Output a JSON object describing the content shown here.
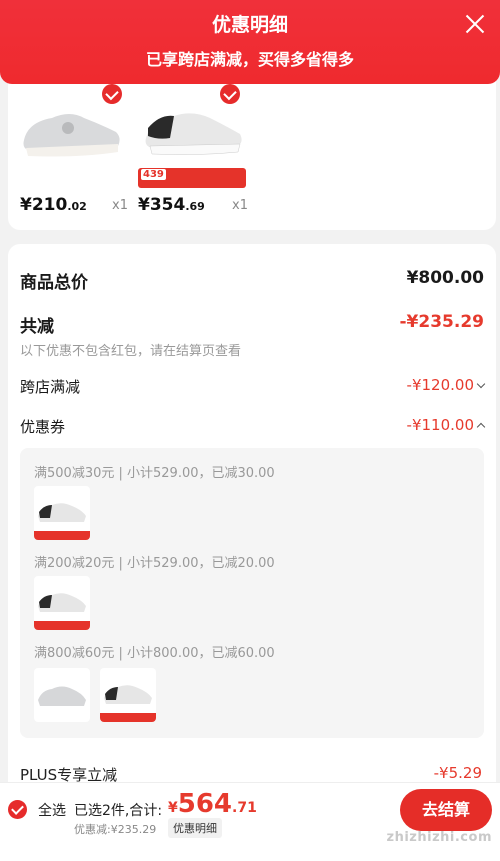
{
  "header": {
    "title": "优惠明细",
    "subtitle": "已享跨店满减，买得多省得多"
  },
  "products": [
    {
      "price_int": "¥210",
      "price_dec": ".02",
      "qty": "x1",
      "selected": true
    },
    {
      "price_int": "¥354",
      "price_dec": ".69",
      "qty": "x1",
      "selected": true,
      "promo_price": "439"
    }
  ],
  "summary": {
    "total_label": "商品总价",
    "total_value": "¥800.00",
    "reduce_label": "共减",
    "reduce_value": "-¥235.29",
    "note": "以下优惠不包含红包，请在结算页查看",
    "cross_label": "跨店满减",
    "cross_value": "-¥120.00",
    "coupon_label": "优惠券",
    "coupon_value": "-¥110.00"
  },
  "coupons": [
    {
      "text": "满500减30元 | 小计529.00，已减30.00"
    },
    {
      "text": "满200减20元 | 小计529.00，已减20.00"
    },
    {
      "text": "满800减60元 | 小计800.00，已减60.00"
    }
  ],
  "plus": {
    "label": "PLUS专享立减",
    "value": "-¥5.29"
  },
  "footer": {
    "select_all": "全选",
    "selected": "已选2件,合计:",
    "currency": "¥",
    "total_int": "564",
    "total_dec": ".71",
    "discount": "优惠减:¥235.29",
    "detail": "优惠明细",
    "button": "去结算",
    "watermark": "zhizhizhi.com"
  },
  "colors": {
    "accent": "#e62b2b",
    "header": "#f0303a"
  }
}
